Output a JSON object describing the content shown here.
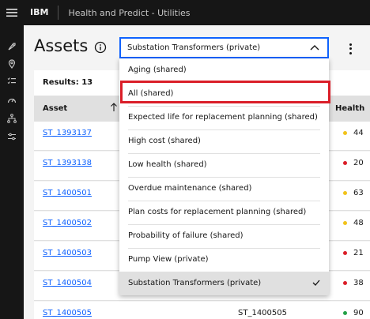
{
  "header": {
    "brand": "IBM",
    "app_title": "Health and Predict - Utilities"
  },
  "page": {
    "title": "Assets"
  },
  "select": {
    "value": "Substation Transformers (private)"
  },
  "table": {
    "results_label": "Results: 13",
    "columns": {
      "asset": "Asset",
      "health": "Health"
    },
    "rows": [
      {
        "asset": "ST_1393137",
        "description": "",
        "health": "44",
        "health_color": "#f1c21b"
      },
      {
        "asset": "ST_1393138",
        "description": "",
        "health": "20",
        "health_color": "#da1e28"
      },
      {
        "asset": "ST_1400501",
        "description": "",
        "health": "63",
        "health_color": "#f1c21b"
      },
      {
        "asset": "ST_1400502",
        "description": "",
        "health": "48",
        "health_color": "#f1c21b"
      },
      {
        "asset": "ST_1400503",
        "description": "",
        "health": "21",
        "health_color": "#da1e28"
      },
      {
        "asset": "ST_1400504",
        "description": "",
        "health": "38",
        "health_color": "#da1e28"
      },
      {
        "asset": "ST_1400505",
        "description": "ST_1400505",
        "health": "90",
        "health_color": "#24a148"
      }
    ]
  },
  "menu": {
    "items": [
      {
        "label": "Aging (shared)"
      },
      {
        "label": "All (shared)"
      },
      {
        "label": "Expected life for replacement planning (shared)"
      },
      {
        "label": "High cost (shared)"
      },
      {
        "label": "Low health (shared)"
      },
      {
        "label": "Overdue maintenance (shared)"
      },
      {
        "label": "Plan costs for replacement planning (shared)"
      },
      {
        "label": "Probability of failure (shared)"
      },
      {
        "label": "Pump View (private)"
      },
      {
        "label": "Substation Transformers (private)"
      }
    ]
  },
  "colors": {
    "accent": "#0f62fe",
    "highlight": "#da1e28",
    "header_bg": "#161616"
  },
  "icons": [
    "menu-icon",
    "rocket-icon",
    "location-icon",
    "checklist-icon",
    "gauge-icon",
    "hierarchy-icon",
    "settings-sliders-icon",
    "info-icon",
    "chevron-up-icon",
    "overflow-menu-icon",
    "sort-arrow-icon",
    "checkmark-icon"
  ]
}
